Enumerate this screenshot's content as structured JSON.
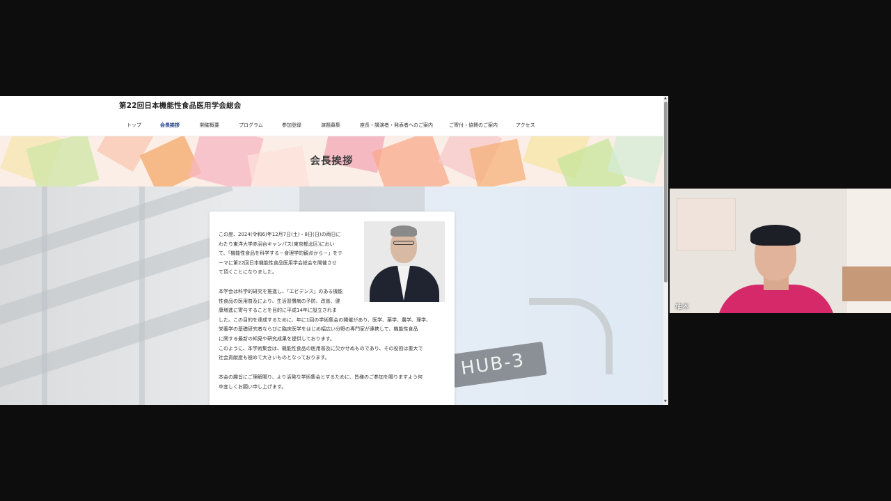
{
  "site": {
    "title": "第22回日本機能性食品医用学会総会",
    "nav": [
      {
        "label": "トップ",
        "active": false
      },
      {
        "label": "会長挨拶",
        "active": true
      },
      {
        "label": "開催概要",
        "active": false
      },
      {
        "label": "プログラム",
        "active": false
      },
      {
        "label": "参加登録",
        "active": false
      },
      {
        "label": "演題募集",
        "active": false
      },
      {
        "label": "座長・講演者・発表者へのご案内",
        "active": false
      },
      {
        "label": "ご寄付・協賛のご案内",
        "active": false
      },
      {
        "label": "アクセス",
        "active": false
      }
    ],
    "page_heading": "会長挨拶"
  },
  "greeting": {
    "para1": [
      "この度、2024(令和6)年12月7日(土)・8日(日)の両日に",
      "わたり東洋大学赤羽台キャンパス(東京都北区)におい",
      "て、「機能性食品を科学する－食理学的観点から－」をテ",
      "ーマに第22回日本機能性食品医用学会総会を開催させ",
      "て頂くことになりました。"
    ],
    "para2": [
      "本学会は科学的研究を推進し、「エビデンス」のある機能",
      "性食品の医用普及により、生活習慣病の予防、改善、健",
      "康増進に寄与することを目的に平成14年に設立されま",
      "した。この目的を達成するために、年に1回の学術集会の開催があり、医学、薬学、農学、理学、",
      "栄養学の基礎研究者ならびに臨床医学をはじめ幅広い分野の専門家が連携して、機能性食品",
      "に関する最新の知見や研究成果を提供しております。",
      "このように、本学術集会は、機能性食品の医用普及に欠かせぬものであり、その役割は重大で",
      "社会貢献度も極めて大きいものとなっております。"
    ],
    "para3": [
      "本会の趣旨にご理解賜り、より活発な学術集会とするために、皆様のご参加を賜りますよう何",
      "卒宜しくお願い申し上げます。"
    ]
  },
  "background_sign": "HUB-3",
  "video": {
    "participant_name": "柚木"
  },
  "colors": {
    "nav_active": "#1f3c88",
    "shirt": "#d6296a"
  }
}
